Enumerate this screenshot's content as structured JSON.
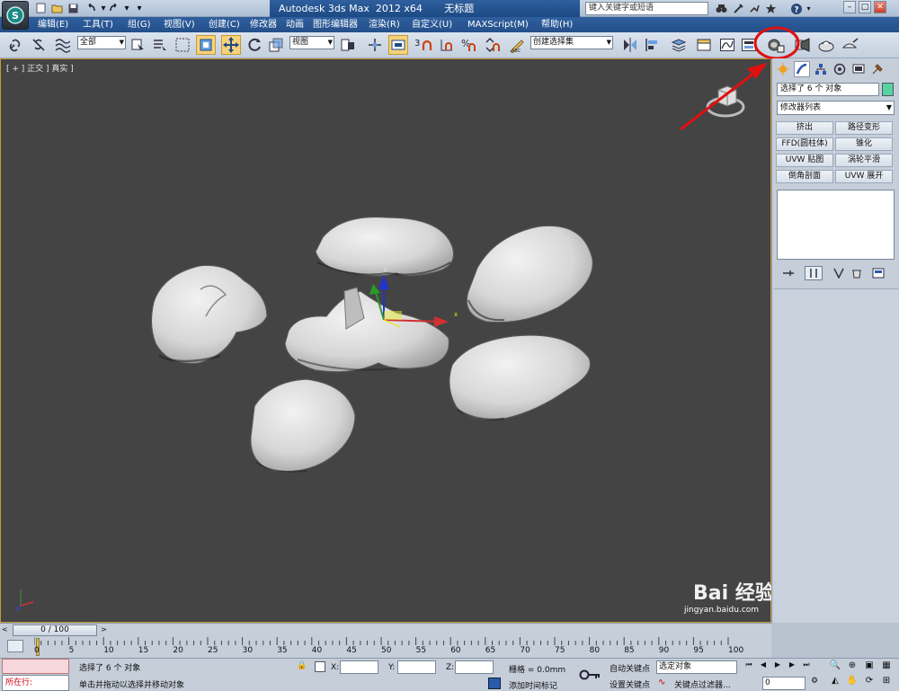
{
  "window": {
    "title": "Autodesk 3ds Max  2012 x64       无标题",
    "search_placeholder": "键入关键字或短语"
  },
  "menu": [
    "编辑(E)",
    "工具(T)",
    "组(G)",
    "视图(V)",
    "创建(C)",
    "修改器",
    "动画",
    "图形编辑器",
    "渲染(R)",
    "自定义(U)",
    "MAXScript(M)",
    "帮助(H)"
  ],
  "toolbar": {
    "selection_filter": "全部",
    "reference_coord": "视图",
    "named_selection": "创建选择集",
    "snap_angle_label": "3"
  },
  "viewport": {
    "label": "[ + ] 正交 ] 真实 ]",
    "gizmo_axis_x": "x",
    "gizmo_axis_z": "z"
  },
  "command_panel": {
    "selection_name": "选择了 6 个 对象",
    "modifier_list": "修改器列表",
    "modifier_buttons": [
      "挤出",
      "路径变形",
      "FFD(圆柱体)",
      "锥化",
      "UVW 贴图",
      "涡轮平滑",
      "倒角剖面",
      "UVW 展开"
    ]
  },
  "timeline": {
    "frame_display": "0 / 100",
    "ticks": [
      "0",
      "5",
      "10",
      "15",
      "20",
      "25",
      "30",
      "35",
      "40",
      "45",
      "50",
      "55",
      "60",
      "65",
      "70",
      "75",
      "80",
      "85",
      "90",
      "95",
      "100"
    ]
  },
  "status": {
    "running_label": "所在行:",
    "selection_status": "选择了 6 个 对象",
    "prompt": "单击并拖动以选择并移动对象",
    "x_label": "X:",
    "y_label": "Y:",
    "z_label": "Z:",
    "grid": "栅格 = 0.0mm",
    "add_time_tag": "添加时间标记",
    "auto_key": "自动关键点",
    "set_key": "设置关键点",
    "key_mode": "选定对象",
    "key_filters": "关键点过滤器...",
    "current_frame": "0"
  },
  "watermark": {
    "text": "Bai 经验",
    "url": "jingyan.baidu.com"
  },
  "colors": {
    "accent_blue": "#244f8a",
    "active_yellow": "#f7d27b",
    "annotation_red": "#e01010",
    "viewport_bg": "#444444"
  }
}
